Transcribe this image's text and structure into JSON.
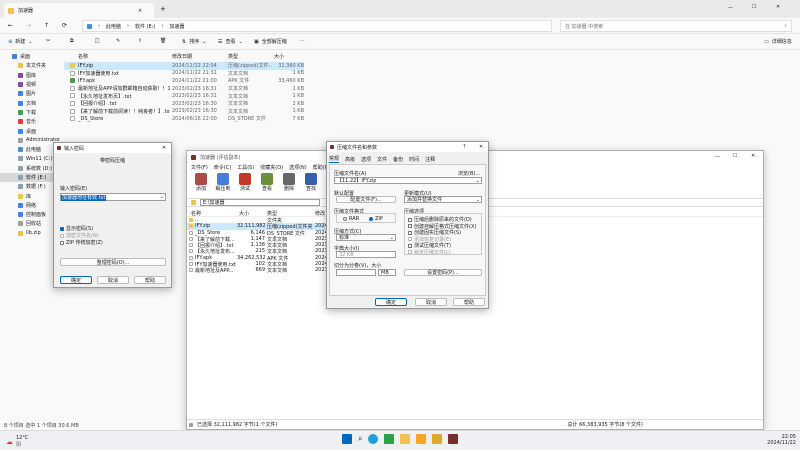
{
  "explorer": {
    "tab_title": "加速器",
    "tab_close": "×",
    "tab_add": "+",
    "win_min": "—",
    "win_max": "☐",
    "win_close": "✕",
    "address": [
      "此电脑",
      "软件 (E:)",
      "加速器"
    ],
    "search_placeholder": "在 加速器 中搜索",
    "toolbar": {
      "new": "新建",
      "cut": "剪切",
      "copy": "复制",
      "paste": "粘贴",
      "rename": "重命名",
      "share": "共享",
      "delete": "删除",
      "sort": "排序",
      "view": "查看",
      "select_all": "全部解压缩",
      "more": "···",
      "details": "详细信息"
    },
    "columns": {
      "name": "名称",
      "date": "修改日期",
      "type": "类型",
      "size": "大小"
    },
    "files": [
      {
        "name": "IFY.zip",
        "date": "2024/11/22 22:04",
        "type": "压缩(zipped)文件...",
        "size": "31,360 KB",
        "icon": "zip"
      },
      {
        "name": "IFY加速器使用.txt",
        "date": "2024/11/22 21:31",
        "type": "文本文档",
        "size": "1 KB",
        "icon": "txt"
      },
      {
        "name": "IFY.apk",
        "date": "2024/11/22 21:00",
        "type": "APK 文件",
        "size": "33,460 KB",
        "icon": "apk"
      },
      {
        "name": "最新地址及APP请加群邮箱自动获取！！1 ...",
        "date": "2023/02/23 16:31",
        "type": "文本文档",
        "size": "1 KB",
        "icon": "txt"
      },
      {
        "name": "【永久地址发布页】.txt",
        "date": "2023/02/23 16:31",
        "type": "文本文档",
        "size": "1 KB",
        "icon": "txt"
      },
      {
        "name": "【回报介绍】.txt",
        "date": "2023/02/23 16:30",
        "type": "文本文档",
        "size": "2 KB",
        "icon": "txt"
      },
      {
        "name": "【来了解前下载前阅读！！纯良者！】.txt",
        "date": "2023/02/23 16:30",
        "type": "文本文档",
        "size": "1 KB",
        "icon": "txt"
      },
      {
        "name": "_DS_Store",
        "date": "2024/06/16 22:00",
        "type": "DS_STORE 文件",
        "size": "7 KB",
        "icon": "file"
      }
    ],
    "sidebar": [
      {
        "label": "桌面",
        "icon": "desktop"
      },
      {
        "label": "本文件夹",
        "icon": "folder"
      },
      {
        "label": "图库",
        "icon": "gallery"
      },
      {
        "label": "视频",
        "icon": "video"
      },
      {
        "label": "图片",
        "icon": "picture"
      },
      {
        "label": "文档",
        "icon": "doc"
      },
      {
        "label": "下载",
        "icon": "download"
      },
      {
        "label": "音乐",
        "icon": "music"
      },
      {
        "label": "桌面",
        "icon": "desktop"
      },
      {
        "label": "Administrator",
        "icon": "user"
      },
      {
        "label": "此电脑",
        "icon": "pc"
      },
      {
        "label": "Win11 (C:)",
        "icon": "drive"
      },
      {
        "label": "系统数 (D:)",
        "icon": "drive"
      },
      {
        "label": "软件 (E:)",
        "icon": "drive",
        "selected": true
      },
      {
        "label": "数据 (F:)",
        "icon": "drive"
      },
      {
        "label": "库",
        "icon": "folder"
      },
      {
        "label": "网络",
        "icon": "network"
      },
      {
        "label": "控制面板",
        "icon": "control"
      },
      {
        "label": "回收站",
        "icon": "recycle"
      },
      {
        "label": "lib.zip",
        "icon": "zip"
      }
    ],
    "status": "8 个项目    选中 1 个项目 30.6 MB"
  },
  "pwd_dialog": {
    "title": "输入密码",
    "close": "✕",
    "heading": "带密码压缩",
    "label_pwd": "输入密码(E)",
    "pwd_value": "加速器地址有效.txt",
    "show_pwd": "显示密码(S)",
    "show_hint": "加密文件名(N)",
    "zip_compat": "ZIP 传统加密(Z)",
    "manage": "整理密码(O)...",
    "ok": "确定",
    "cancel": "取消",
    "help": "帮助"
  },
  "bandizip": {
    "title": "加速器 (评估副本)",
    "menu": [
      "文件(F)",
      "命令(C)",
      "工具(S)",
      "收藏夹(O)",
      "选项(N)",
      "帮助(H)"
    ],
    "toolbar": [
      "添加",
      "解压到",
      "测试",
      "查看",
      "删除",
      "查找"
    ],
    "path": "E:\\加速器",
    "cols": {
      "name": "名称",
      "size": "大小",
      "type": "类型",
      "mod": "修改"
    },
    "rows": [
      {
        "name": "..",
        "size": "",
        "type": "文件夹",
        "mod": ""
      },
      {
        "name": "IFY.zip",
        "size": "32,111,982",
        "type": "压缩(zipped)文件夹",
        "mod": "2024"
      },
      {
        "name": "_DS_Store",
        "size": "6,146",
        "type": "DS_STORE 文件",
        "mod": "2024"
      },
      {
        "name": "【来了解前下载...",
        "size": "1,147",
        "type": "文本文档",
        "mod": "2023"
      },
      {
        "name": "【回报介绍】.txt",
        "size": "1,138",
        "type": "文本文档",
        "mod": "2023"
      },
      {
        "name": "【永久地址发布...",
        "size": "215",
        "type": "文本文档",
        "mod": "2023"
      },
      {
        "name": "IFY.apk",
        "size": "34,262,532",
        "type": "APK 文件",
        "mod": "2024"
      },
      {
        "name": "IFY加速器使用.txt",
        "size": "102",
        "type": "文本文档",
        "mod": "2024"
      },
      {
        "name": "最新地址及APP...",
        "size": "669",
        "type": "文本文档",
        "mod": "2023"
      }
    ],
    "status_left": "已选择 32,111,982 字节(1 个文件)",
    "status_right": "总计 66,383,935 字节(8 个文件)"
  },
  "archive_dialog": {
    "title": "压缩文件名和参数",
    "help": "?",
    "close": "✕",
    "tabs": [
      "常规",
      "高级",
      "选项",
      "文件",
      "备份",
      "时间",
      "注释"
    ],
    "archive_name_label": "压缩文件名(A)",
    "browse": "浏览(B)...",
    "archive_name": "【11.22】IFY.zip",
    "default_profile_label": "默认配置",
    "profile_btn": "配置文件(F)...",
    "update_label": "更新模式(U)",
    "update_value": "添加并替换文件",
    "format_label": "压缩文件格式",
    "fmt_rar": "RAR",
    "fmt_zip": "ZIP",
    "options_label": "压缩选项",
    "opts": [
      "压缩后删除原来的文件(D)",
      "创建自解压格式压缩文件(X)",
      "创建固实压缩文件(S)",
      "添加恢复记录(E)",
      "测试压缩文件(T)",
      "锁定压缩文件(L)"
    ],
    "method_label": "压缩方式(C)",
    "method_value": "标准",
    "dict_label": "字典大小(I)",
    "dict_value": "32 KB",
    "split_label": "切分为分卷(V)，大小",
    "split_unit": "MB",
    "set_pwd": "设置密码(P)...",
    "ok": "确定",
    "cancel": "取消",
    "helpbtn": "帮助"
  },
  "taskbar": {
    "weather_temp": "12°C",
    "weather_desc": "阴",
    "time": "22:05",
    "date": "2024/11/22",
    "apps": [
      "start",
      "search",
      "edge",
      "explorer",
      "folder",
      "store",
      "bandizip",
      "winrar"
    ]
  },
  "colors": {
    "accent": "#0067c0",
    "selection": "#cce8ff",
    "winrar": "#7b2d2d"
  }
}
